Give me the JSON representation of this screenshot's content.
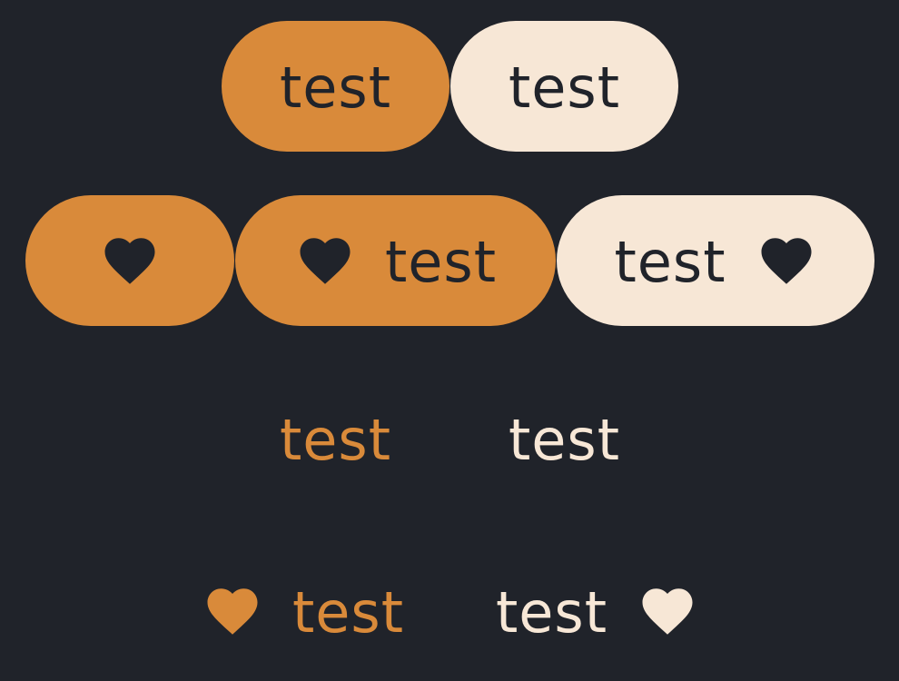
{
  "colors": {
    "background": "#20232a",
    "primary": "#d98a3a",
    "secondary": "#f7e7d6",
    "dark_text": "#20232a"
  },
  "row1": {
    "filled_primary_label": "test",
    "filled_secondary_label": "test"
  },
  "row2": {
    "icon_only_icon": "heart-icon",
    "icon_leading_label": "test",
    "icon_leading_icon": "heart-icon",
    "icon_trailing_label": "test",
    "icon_trailing_icon": "heart-icon"
  },
  "row3": {
    "text_primary_label": "test",
    "text_secondary_label": "test"
  },
  "row4": {
    "text_icon_leading_label": "test",
    "text_icon_leading_icon": "heart-icon",
    "text_icon_trailing_label": "test",
    "text_icon_trailing_icon": "heart-icon"
  }
}
